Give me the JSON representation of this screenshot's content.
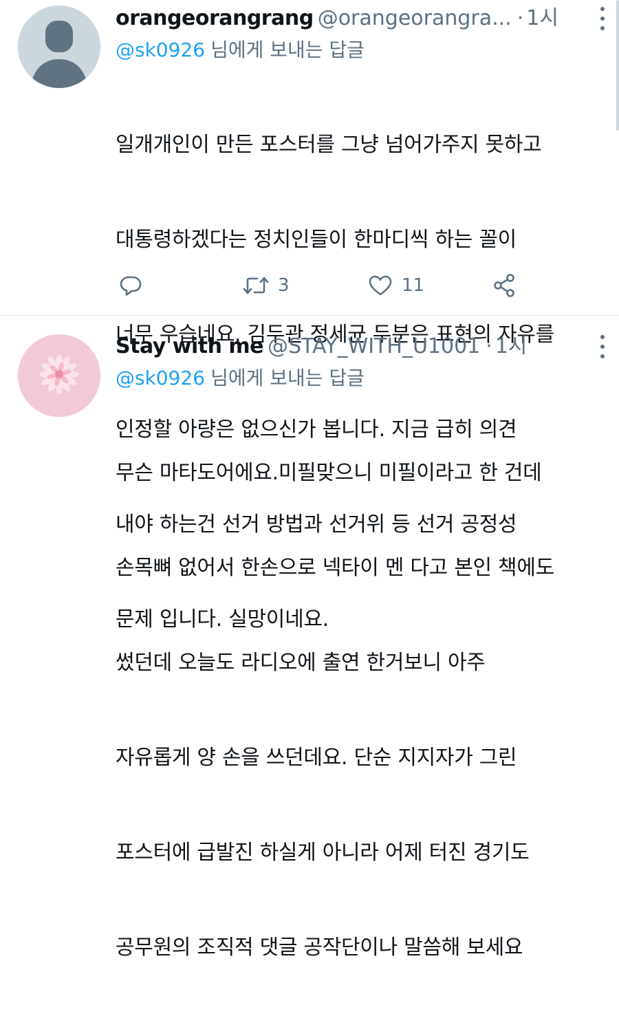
{
  "tweets": [
    {
      "display_name": "orangeorangrang",
      "handle": "@orangeorangra...",
      "dot": "·",
      "time": "1시",
      "reply_to_mention": "@sk0926",
      "reply_to_suffix": "님에게 보내는 답글",
      "body_lines": [
        "일개개인이 만든 포스터를 그냥 넘어가주지 못하고",
        "대통령하겠다는 정치인들이 한마디씩 하는 꼴이",
        "너무 우습네요. 김두관 정세균 두분은 표현의 자유를",
        "인정할 아량은 없으신가 봅니다. 지금 급히 의견",
        "내야 하는건 선거 방법과 선거위 등 선거 공정성",
        "문제 입니다. 실망이네요."
      ],
      "actions": {
        "reply_count": "",
        "retweet_count": "3",
        "like_count": "11"
      },
      "avatar": "default-avatar"
    },
    {
      "display_name": "Stay with me",
      "handle": "@STAY_WITH_U1001",
      "dot": "·",
      "time": "1시",
      "reply_to_mention": "@sk0926",
      "reply_to_suffix": "님에게 보내는 답글",
      "body_lines": [
        "무슨 마타도어에요.미필맞으니 미필이라고 한 건데",
        "손목뼈 없어서 한손으로 넥타이 멘 다고 본인 책에도",
        "썼던데 오늘도 라디오에 출연 한거보니 아주",
        "자유롭게 양 손을 쓰던데요. 단순 지지자가 그린",
        "포스터에 급발진 하실게 아니라 어제 터진 경기도",
        "공무원의 조직적 댓글 공작단이나 말씀해 보세요"
      ],
      "avatar": "pink-flower-avatar"
    }
  ],
  "colors": {
    "text_primary": "#0f1419",
    "text_secondary": "#5b7083",
    "accent": "#1da1f2",
    "divider": "#e6ecf0"
  },
  "icons": {
    "reply": "reply-icon",
    "retweet": "retweet-icon",
    "like": "heart-icon",
    "share": "share-icon",
    "more": "more-vertical-icon"
  }
}
